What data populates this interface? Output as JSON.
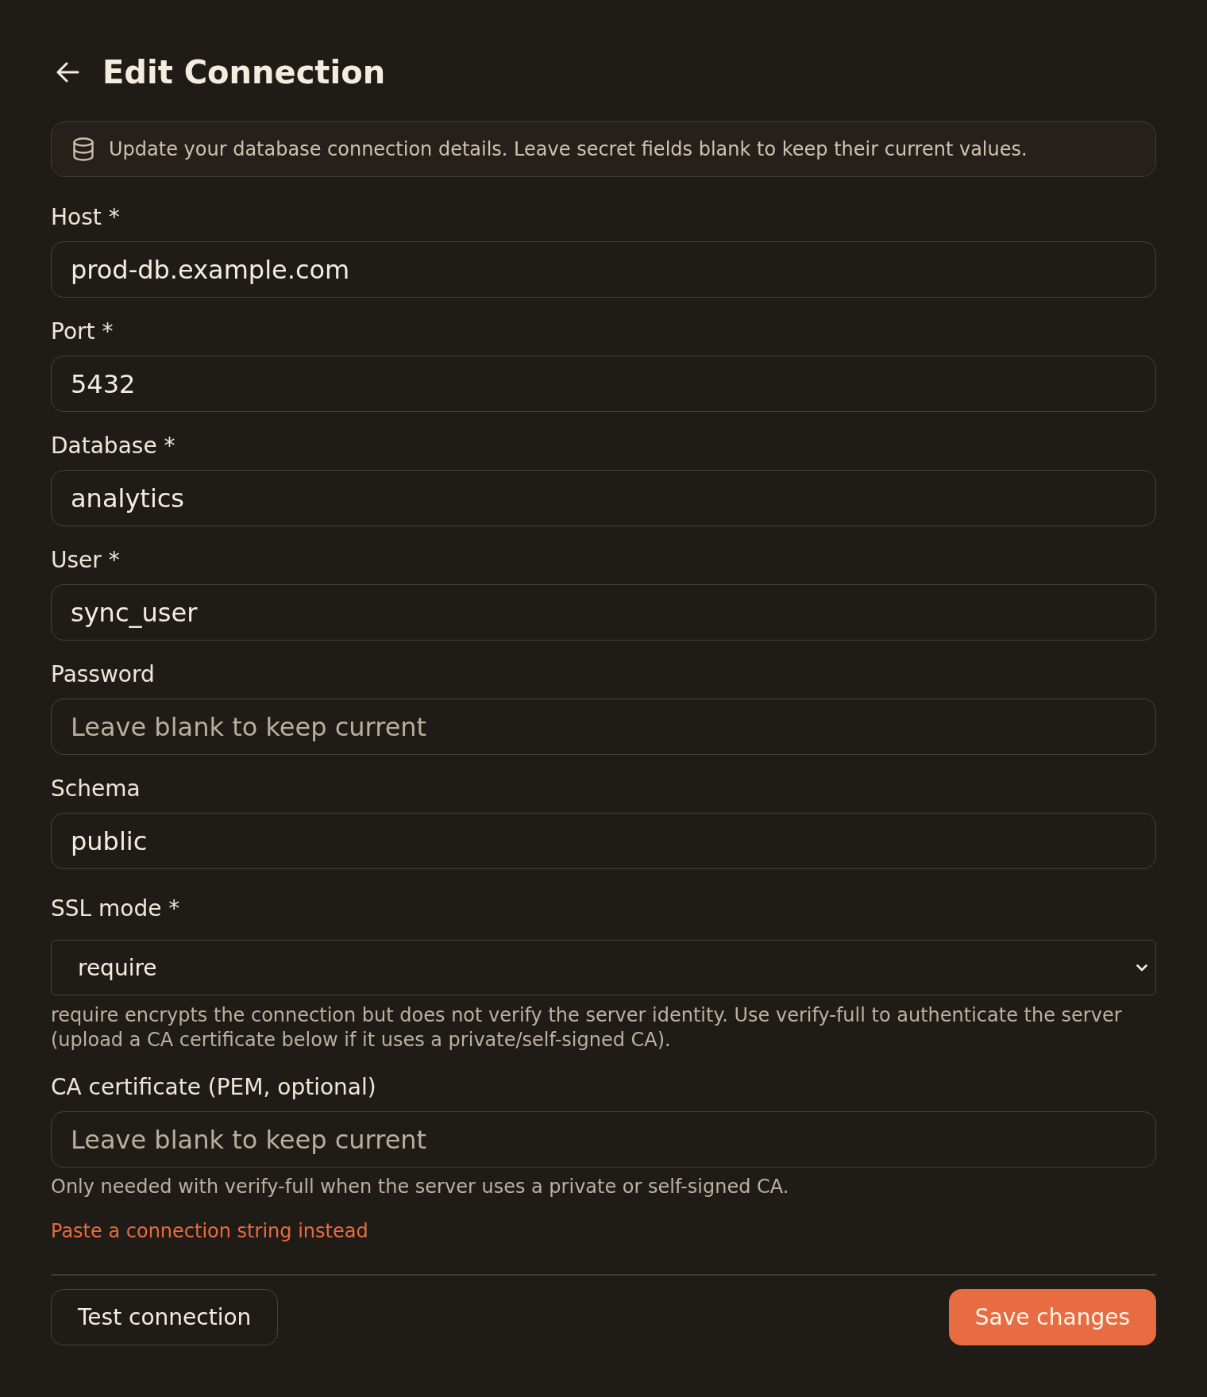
{
  "header": {
    "title": "Edit Connection"
  },
  "notice": {
    "text": "Update your database connection details. Leave secret fields blank to keep their current values."
  },
  "fields": [
    {
      "kind": "text",
      "label": "Host *",
      "value": "prod-db.example.com"
    },
    {
      "kind": "text",
      "label": "Port *",
      "value": "5432"
    },
    {
      "kind": "text",
      "label": "Database *",
      "value": "analytics"
    },
    {
      "kind": "text",
      "label": "User *",
      "value": "sync_user"
    },
    {
      "kind": "text",
      "label": "Password",
      "placeholder": "Leave blank to keep current"
    },
    {
      "kind": "text",
      "label": "Schema",
      "value": "public"
    },
    {
      "kind": "select",
      "label": "SSL mode *",
      "value": "require",
      "help": "require encrypts the connection but does not verify the server identity. Use verify-full to authenticate the server (upload a CA certificate below if it uses a private/self-signed CA)."
    },
    {
      "kind": "text",
      "label": "CA certificate (PEM, optional)",
      "placeholder": "Leave blank to keep current",
      "help": "Only needed with verify-full when the server uses a private or self-signed CA."
    }
  ],
  "link": {
    "text": "Paste a connection string instead"
  },
  "buttons": [
    {
      "kind": "secondary",
      "label": "Test connection"
    },
    {
      "kind": "primary",
      "label": "Save changes"
    }
  ]
}
